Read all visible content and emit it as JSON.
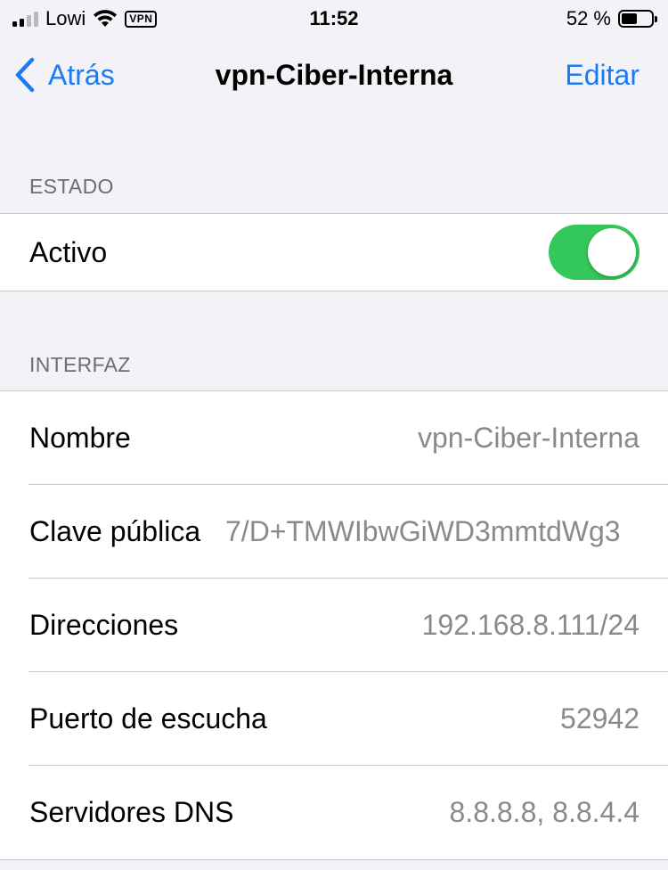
{
  "status_bar": {
    "carrier": "Lowi",
    "vpn_badge": "VPN",
    "time": "11:52",
    "battery_percent": "52 %",
    "battery_level": 0.52,
    "signal_bars_active": 2,
    "signal_bars_total": 4
  },
  "nav": {
    "back_label": "Atrás",
    "title": "vpn-Ciber-Interna",
    "edit_label": "Editar"
  },
  "estado": {
    "header": "ESTADO",
    "active_label": "Activo",
    "active_on": true,
    "toggle_color": "#34c759"
  },
  "interfaz": {
    "header": "INTERFAZ",
    "rows": [
      {
        "label": "Nombre",
        "value": "vpn-Ciber-Interna"
      },
      {
        "label": "Clave pública",
        "value": "7/D+TMWIbwGiWD3mmtdWg3"
      },
      {
        "label": "Direcciones",
        "value": "192.168.8.111/24"
      },
      {
        "label": "Puerto de escucha",
        "value": "52942"
      },
      {
        "label": "Servidores DNS",
        "value": "8.8.8.8, 8.8.4.4"
      }
    ]
  },
  "colors": {
    "accent": "#1a7cf5",
    "background": "#f2f2f7"
  }
}
